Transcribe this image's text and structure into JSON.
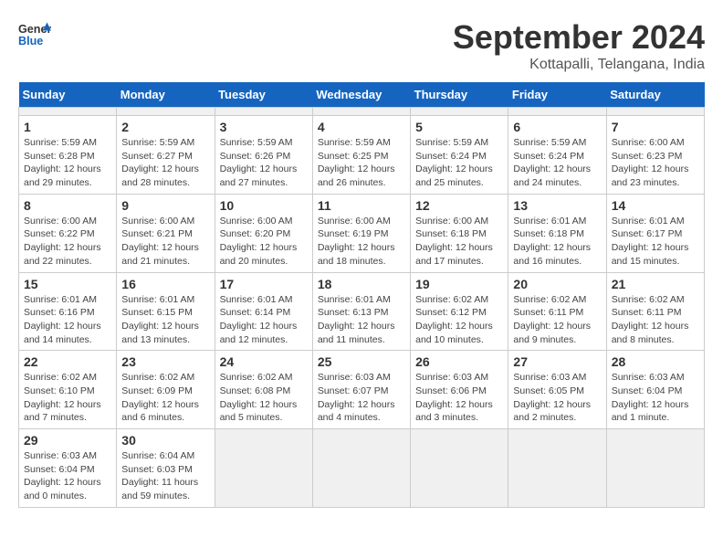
{
  "header": {
    "logo_general": "General",
    "logo_blue": "Blue",
    "month_title": "September 2024",
    "location": "Kottapalli, Telangana, India"
  },
  "weekdays": [
    "Sunday",
    "Monday",
    "Tuesday",
    "Wednesday",
    "Thursday",
    "Friday",
    "Saturday"
  ],
  "days": [
    {
      "num": "",
      "empty": true
    },
    {
      "num": "",
      "empty": true
    },
    {
      "num": "",
      "empty": true
    },
    {
      "num": "",
      "empty": true
    },
    {
      "num": "",
      "empty": true
    },
    {
      "num": "",
      "empty": true
    },
    {
      "num": "",
      "empty": true
    },
    {
      "num": "1",
      "sunrise": "Sunrise: 5:59 AM",
      "sunset": "Sunset: 6:28 PM",
      "daylight": "Daylight: 12 hours and 29 minutes."
    },
    {
      "num": "2",
      "sunrise": "Sunrise: 5:59 AM",
      "sunset": "Sunset: 6:27 PM",
      "daylight": "Daylight: 12 hours and 28 minutes."
    },
    {
      "num": "3",
      "sunrise": "Sunrise: 5:59 AM",
      "sunset": "Sunset: 6:26 PM",
      "daylight": "Daylight: 12 hours and 27 minutes."
    },
    {
      "num": "4",
      "sunrise": "Sunrise: 5:59 AM",
      "sunset": "Sunset: 6:25 PM",
      "daylight": "Daylight: 12 hours and 26 minutes."
    },
    {
      "num": "5",
      "sunrise": "Sunrise: 5:59 AM",
      "sunset": "Sunset: 6:24 PM",
      "daylight": "Daylight: 12 hours and 25 minutes."
    },
    {
      "num": "6",
      "sunrise": "Sunrise: 5:59 AM",
      "sunset": "Sunset: 6:24 PM",
      "daylight": "Daylight: 12 hours and 24 minutes."
    },
    {
      "num": "7",
      "sunrise": "Sunrise: 6:00 AM",
      "sunset": "Sunset: 6:23 PM",
      "daylight": "Daylight: 12 hours and 23 minutes."
    },
    {
      "num": "8",
      "sunrise": "Sunrise: 6:00 AM",
      "sunset": "Sunset: 6:22 PM",
      "daylight": "Daylight: 12 hours and 22 minutes."
    },
    {
      "num": "9",
      "sunrise": "Sunrise: 6:00 AM",
      "sunset": "Sunset: 6:21 PM",
      "daylight": "Daylight: 12 hours and 21 minutes."
    },
    {
      "num": "10",
      "sunrise": "Sunrise: 6:00 AM",
      "sunset": "Sunset: 6:20 PM",
      "daylight": "Daylight: 12 hours and 20 minutes."
    },
    {
      "num": "11",
      "sunrise": "Sunrise: 6:00 AM",
      "sunset": "Sunset: 6:19 PM",
      "daylight": "Daylight: 12 hours and 18 minutes."
    },
    {
      "num": "12",
      "sunrise": "Sunrise: 6:00 AM",
      "sunset": "Sunset: 6:18 PM",
      "daylight": "Daylight: 12 hours and 17 minutes."
    },
    {
      "num": "13",
      "sunrise": "Sunrise: 6:01 AM",
      "sunset": "Sunset: 6:18 PM",
      "daylight": "Daylight: 12 hours and 16 minutes."
    },
    {
      "num": "14",
      "sunrise": "Sunrise: 6:01 AM",
      "sunset": "Sunset: 6:17 PM",
      "daylight": "Daylight: 12 hours and 15 minutes."
    },
    {
      "num": "15",
      "sunrise": "Sunrise: 6:01 AM",
      "sunset": "Sunset: 6:16 PM",
      "daylight": "Daylight: 12 hours and 14 minutes."
    },
    {
      "num": "16",
      "sunrise": "Sunrise: 6:01 AM",
      "sunset": "Sunset: 6:15 PM",
      "daylight": "Daylight: 12 hours and 13 minutes."
    },
    {
      "num": "17",
      "sunrise": "Sunrise: 6:01 AM",
      "sunset": "Sunset: 6:14 PM",
      "daylight": "Daylight: 12 hours and 12 minutes."
    },
    {
      "num": "18",
      "sunrise": "Sunrise: 6:01 AM",
      "sunset": "Sunset: 6:13 PM",
      "daylight": "Daylight: 12 hours and 11 minutes."
    },
    {
      "num": "19",
      "sunrise": "Sunrise: 6:02 AM",
      "sunset": "Sunset: 6:12 PM",
      "daylight": "Daylight: 12 hours and 10 minutes."
    },
    {
      "num": "20",
      "sunrise": "Sunrise: 6:02 AM",
      "sunset": "Sunset: 6:11 PM",
      "daylight": "Daylight: 12 hours and 9 minutes."
    },
    {
      "num": "21",
      "sunrise": "Sunrise: 6:02 AM",
      "sunset": "Sunset: 6:11 PM",
      "daylight": "Daylight: 12 hours and 8 minutes."
    },
    {
      "num": "22",
      "sunrise": "Sunrise: 6:02 AM",
      "sunset": "Sunset: 6:10 PM",
      "daylight": "Daylight: 12 hours and 7 minutes."
    },
    {
      "num": "23",
      "sunrise": "Sunrise: 6:02 AM",
      "sunset": "Sunset: 6:09 PM",
      "daylight": "Daylight: 12 hours and 6 minutes."
    },
    {
      "num": "24",
      "sunrise": "Sunrise: 6:02 AM",
      "sunset": "Sunset: 6:08 PM",
      "daylight": "Daylight: 12 hours and 5 minutes."
    },
    {
      "num": "25",
      "sunrise": "Sunrise: 6:03 AM",
      "sunset": "Sunset: 6:07 PM",
      "daylight": "Daylight: 12 hours and 4 minutes."
    },
    {
      "num": "26",
      "sunrise": "Sunrise: 6:03 AM",
      "sunset": "Sunset: 6:06 PM",
      "daylight": "Daylight: 12 hours and 3 minutes."
    },
    {
      "num": "27",
      "sunrise": "Sunrise: 6:03 AM",
      "sunset": "Sunset: 6:05 PM",
      "daylight": "Daylight: 12 hours and 2 minutes."
    },
    {
      "num": "28",
      "sunrise": "Sunrise: 6:03 AM",
      "sunset": "Sunset: 6:04 PM",
      "daylight": "Daylight: 12 hours and 1 minute."
    },
    {
      "num": "29",
      "sunrise": "Sunrise: 6:03 AM",
      "sunset": "Sunset: 6:04 PM",
      "daylight": "Daylight: 12 hours and 0 minutes."
    },
    {
      "num": "30",
      "sunrise": "Sunrise: 6:04 AM",
      "sunset": "Sunset: 6:03 PM",
      "daylight": "Daylight: 11 hours and 59 minutes."
    },
    {
      "num": "",
      "empty": true
    },
    {
      "num": "",
      "empty": true
    },
    {
      "num": "",
      "empty": true
    },
    {
      "num": "",
      "empty": true
    },
    {
      "num": "",
      "empty": true
    }
  ]
}
